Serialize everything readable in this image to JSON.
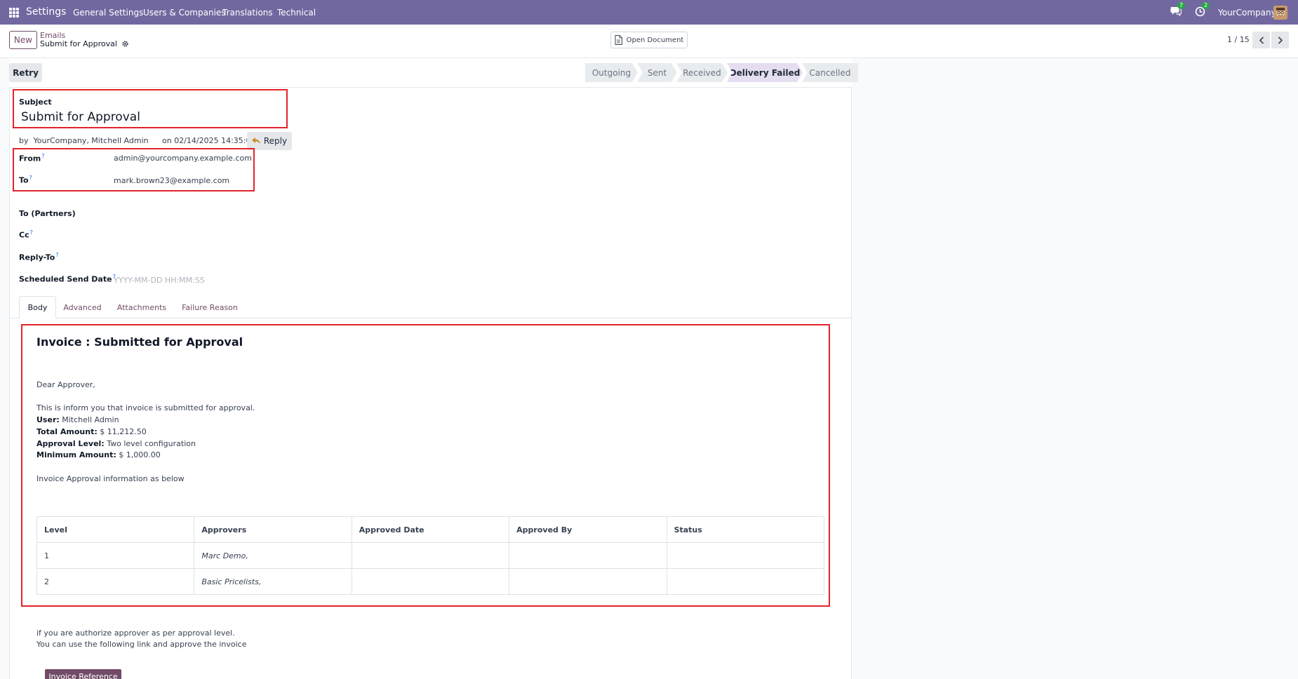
{
  "navbar": {
    "app_name": "Settings",
    "menu": [
      "General Settings",
      "Users & Companies",
      "Translations",
      "Technical"
    ],
    "messages_badge": "7",
    "activities_badge": "2",
    "company": "YourCompany"
  },
  "control_panel": {
    "new_label": "New",
    "breadcrumb_parent": "Emails",
    "breadcrumb_current": "Submit for Approval",
    "open_document_label": "Open Document",
    "pager": "1 / 15"
  },
  "statusbar": {
    "retry_label": "Retry",
    "stages": [
      "Outgoing",
      "Sent",
      "Received",
      "Delivery Failed",
      "Cancelled"
    ],
    "active_stage": "Delivery Failed"
  },
  "form": {
    "subject_label": "Subject",
    "subject_value": "Submit for Approval",
    "by_prefix": "by",
    "author": "YourCompany, Mitchell Admin",
    "date_text": "on 02/14/2025 14:35:04",
    "reply_label": "Reply",
    "from_label": "From",
    "from_value": "admin@yourcompany.example.com",
    "to_label": "To",
    "to_value": "mark.brown23@example.com",
    "to_partners_label": "To (Partners)",
    "cc_label": "Cc",
    "reply_to_label": "Reply-To",
    "scheduled_label": "Scheduled Send Date",
    "scheduled_placeholder": "YYYY-MM-DD HH:MM:SS",
    "help_mark": "?"
  },
  "tabs": [
    "Body",
    "Advanced",
    "Attachments",
    "Failure Reason"
  ],
  "body": {
    "heading": "Invoice : Submitted for Approval",
    "greeting": "Dear Approver,",
    "intro": "This is inform you that invoice is submitted for approval.",
    "user_label": "User:",
    "user_value": " Mitchell Admin",
    "total_label": "Total Amount:",
    "total_value": " $ 11,212.50",
    "level_label": "Approval Level:",
    "level_value": " Two level configuration",
    "min_label": "Minimum Amount:",
    "min_value": " $ 1,000.00",
    "info_line": "Invoice Approval information as below",
    "table": {
      "headers": [
        "Level",
        "Approvers",
        "Approved Date",
        "Approved By",
        "Status"
      ],
      "rows": [
        [
          "1",
          "Marc Demo,",
          "",
          "",
          ""
        ],
        [
          "2",
          "Basic Pricelists,",
          "",
          "",
          ""
        ]
      ]
    },
    "footer_line1": "if you are authorize approver as per approval level.",
    "footer_line2": "You can use the following link and approve the invoice",
    "invoice_ref_button": "Invoice Reference"
  },
  "colors": {
    "navbar": "#7268a0",
    "primary": "#714b67",
    "highlight_box": "#e3232b"
  }
}
